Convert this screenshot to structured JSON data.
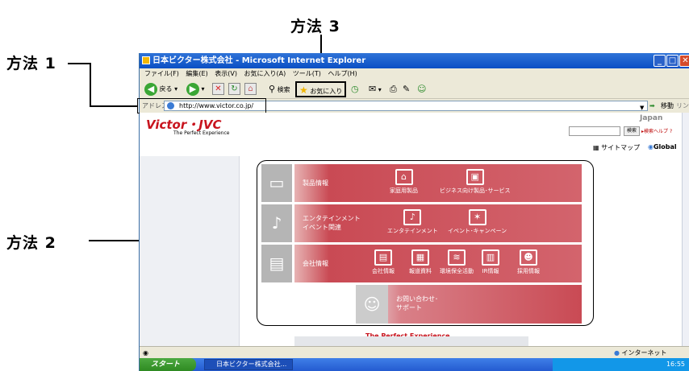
{
  "callouts": {
    "method1": "方法 1",
    "method2": "方法 2",
    "method3": "方法 3"
  },
  "window": {
    "title": "日本ビクター株式会社 - Microsoft Internet Explorer",
    "min": "_",
    "max": "□",
    "close": "✕"
  },
  "menu": [
    "ファイル(F)",
    "編集(E)",
    "表示(V)",
    "お気に入り(A)",
    "ツール(T)",
    "ヘルプ(H)"
  ],
  "toolbar": {
    "back": "戻る",
    "search": "検索",
    "favorites": "お気に入り"
  },
  "address": {
    "label": "アドレス(D)",
    "url": "http://www.victor.co.jp/",
    "go": "移動",
    "links": "リンク"
  },
  "site": {
    "logo": "Victor・JVC",
    "tagline": "The Perfect Experience",
    "region": "Japan",
    "search_button": "検索",
    "search_help": "検索ヘルプ",
    "sitemap": "サイトマップ",
    "global": "Global",
    "footer_tagline": "The Perfect Experience"
  },
  "rows": [
    {
      "label": "製品情報",
      "items": [
        "家庭用製品",
        "ビジネス向け製品･サービス"
      ]
    },
    {
      "label": "エンタテインメント\nイベント関連",
      "items": [
        "エンタテインメント",
        "イベント･キャンペーン"
      ]
    },
    {
      "label": "会社情報",
      "items": [
        "会社情報",
        "報道資料",
        "環境保全活動",
        "IR情報",
        "採用情報"
      ]
    },
    {
      "label": "お問い合わせ･\nサポート",
      "items": []
    }
  ],
  "status": {
    "zone": "インターネット"
  },
  "taskbar": {
    "start": "スタート",
    "task": "日本ビクター株式会社...",
    "time": "16:55"
  }
}
